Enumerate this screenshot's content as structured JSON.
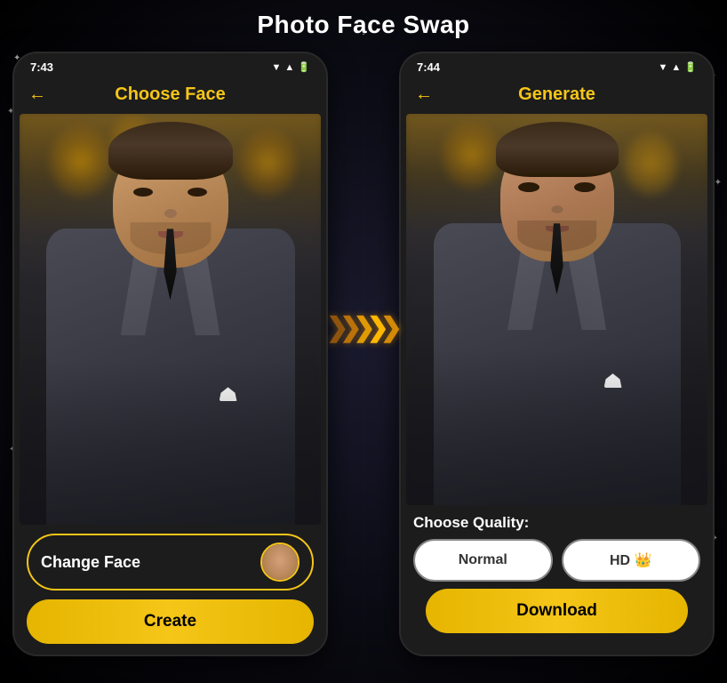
{
  "page": {
    "title": "Photo Face Swap",
    "background_color": "#000000"
  },
  "left_phone": {
    "status_time": "7:43",
    "status_icons": "▼▲4",
    "header_title": "Choose Face",
    "back_label": "←",
    "change_face_label": "Change Face",
    "create_label": "Create"
  },
  "right_phone": {
    "status_time": "7:44",
    "status_icons": "▼▲4",
    "header_title": "Generate",
    "back_label": "←",
    "quality_label": "Choose Quality:",
    "quality_normal_label": "Normal",
    "quality_hd_label": "HD 👑",
    "download_label": "Download"
  },
  "arrows": {
    "symbol": "❯❯❯❯❯"
  }
}
